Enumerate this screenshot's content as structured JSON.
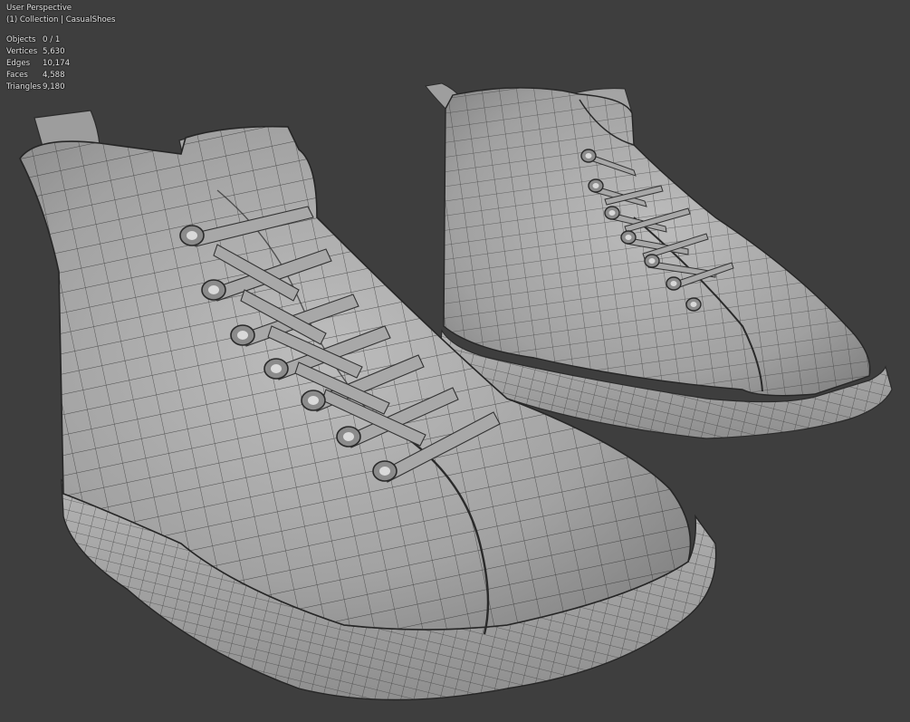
{
  "viewport": {
    "view_name": "User Perspective",
    "collection_line": "(1) Collection | CasualShoes"
  },
  "stats": [
    {
      "label": "Objects",
      "value": "0 / 1"
    },
    {
      "label": "Vertices",
      "value": "5,630"
    },
    {
      "label": "Edges",
      "value": "10,174"
    },
    {
      "label": "Faces",
      "value": "4,588"
    },
    {
      "label": "Triangles",
      "value": "9,180"
    }
  ],
  "colors": {
    "background": "#3e3e3e",
    "mesh_fill": "#a9a9a9",
    "mesh_shade": "#8a8a8a",
    "wire": "#2b2b2b",
    "overlay_text": "#e6e6e6"
  }
}
